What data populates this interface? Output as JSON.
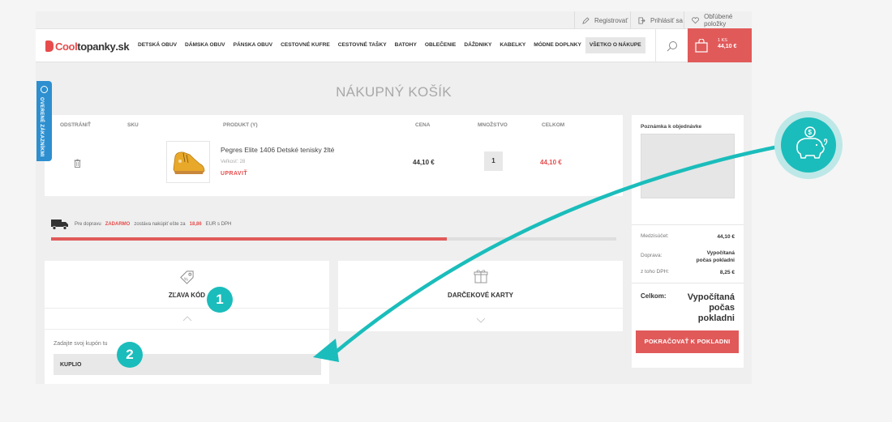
{
  "topbar": {
    "register": "Registrovať",
    "login": "Prihlásiť sa",
    "favorites": "Obľúbené položky"
  },
  "logo": {
    "part1": "Cool",
    "part2": "topanky",
    "part3": ".sk"
  },
  "nav": {
    "items": [
      "DETSKÁ OBUV",
      "DÁMSKA OBUV",
      "PÁNSKA OBUV",
      "CESTOVNÉ KUFRE",
      "CESTOVNÉ TAŠKY",
      "BATOHY",
      "OBLEČENIE",
      "DÁŽDNIKY",
      "KABELKY",
      "MÓDNE DOPLNKY",
      "VŠETKO O NÁKUPE"
    ]
  },
  "cart": {
    "count": "1 KS",
    "price": "44,10 €"
  },
  "verified": {
    "label": "OVERENÉ ZÁKAZNÍKMI"
  },
  "page": {
    "title": "NÁKUPNÝ KOŠÍK"
  },
  "table": {
    "headers": {
      "remove": "ODSTRÁNIŤ",
      "sku": "SKU",
      "product": "PRODUKT (Y)",
      "price": "CENA",
      "qty": "MNOŽSTVO",
      "total": "CELKOM"
    },
    "row": {
      "name": "Pegres Elite 1406 Detské tenisky žlté",
      "size": "Veľkosť: 28",
      "edit": "UPRAVIŤ",
      "price": "44,10 €",
      "qty": "1",
      "total": "44,10 €"
    }
  },
  "shipping": {
    "pre": "Pre dopravu",
    "free": "ZADARMO",
    "mid": "zostáva nakúpiť ešte za",
    "amount": "18,86",
    "post": "EUR s DPH",
    "progress": 0.7
  },
  "coupon": {
    "title": "ZĽAVA KÓD",
    "field_label": "Zadajte svoj kupón tu",
    "value": "KUPLIO"
  },
  "gift": {
    "title": "DARČEKOVÉ KARTY"
  },
  "summary": {
    "note_label": "Poznámka k objednávke",
    "subtotal_label": "Medzisúčet:",
    "subtotal_value": "44,10 €",
    "shipping_label": "Doprava:",
    "shipping_value_1": "Vypočítaná",
    "shipping_value_2": "počas pokladni",
    "vat_label": "z toho DPH:",
    "vat_value": "8,25 €",
    "total_label": "Celkom:",
    "total_value_1": "Vypočítaná",
    "total_value_2": "počas",
    "total_value_3": "pokladni",
    "checkout": "POKRAČOVAŤ K POKLADNI"
  },
  "badges": {
    "one": "1",
    "two": "2"
  },
  "colors": {
    "accent": "#e15a5a",
    "teal": "#1abdbb",
    "verified_blue": "#2d8fcf"
  }
}
